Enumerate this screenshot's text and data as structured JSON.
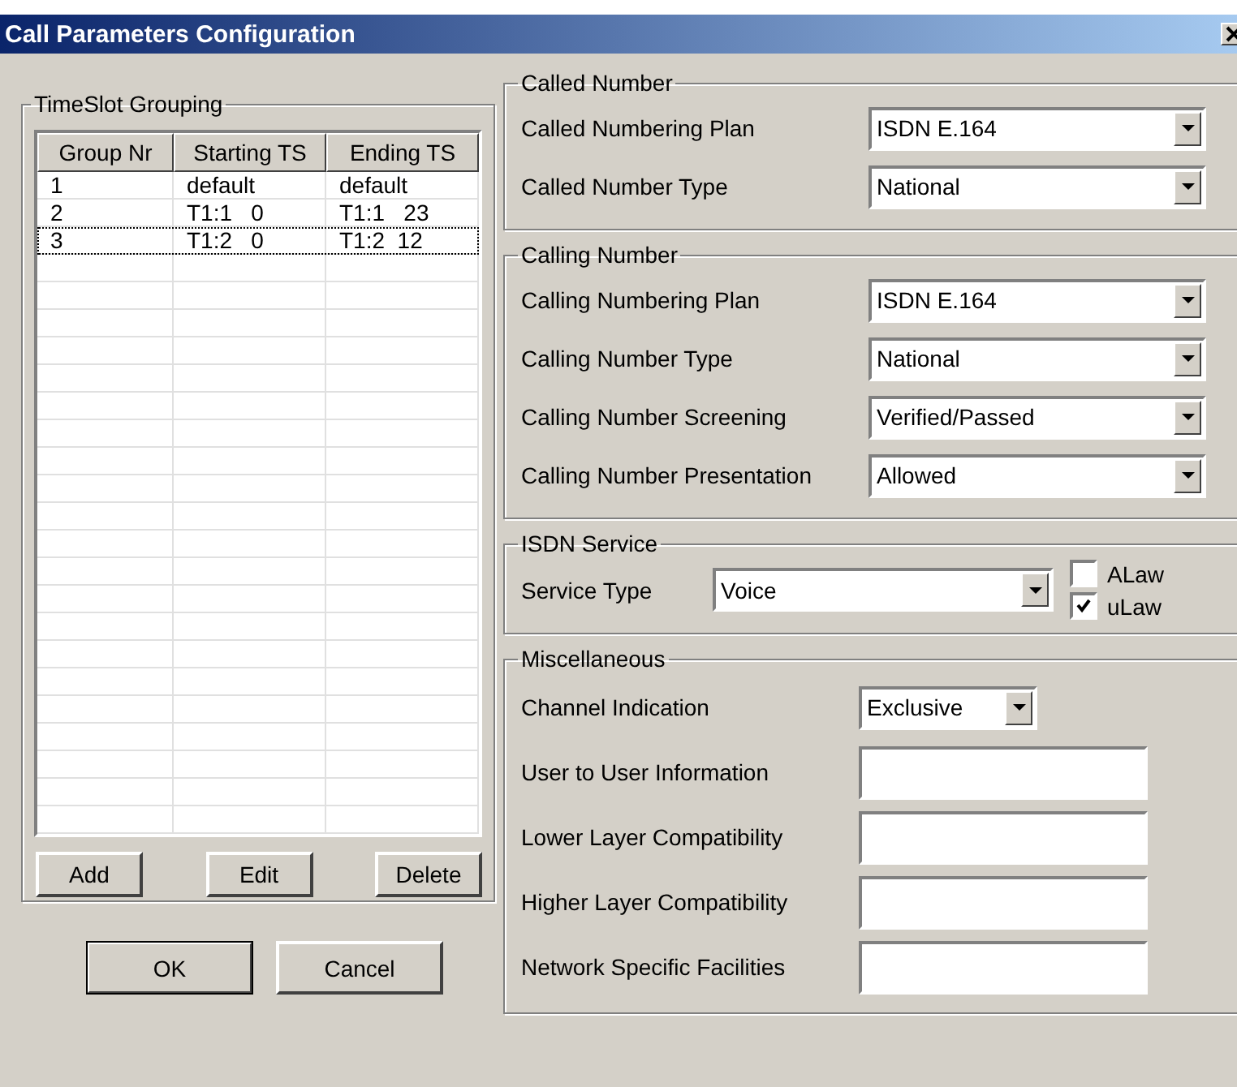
{
  "window": {
    "title": "Call Parameters Configuration"
  },
  "timeslot_grouping": {
    "title": "TimeSlot Grouping",
    "columns": [
      "Group Nr",
      "Starting TS",
      "Ending TS"
    ],
    "rows": [
      {
        "cells": [
          "1",
          "default",
          "default"
        ],
        "selected": false
      },
      {
        "cells": [
          "2",
          "T1:1   0",
          "T1:1   23"
        ],
        "selected": false
      },
      {
        "cells": [
          "3",
          "T1:2   0",
          "T1:2  12"
        ],
        "selected": true
      }
    ],
    "buttons": [
      "Add",
      "Edit",
      "Delete"
    ]
  },
  "dialog_buttons": [
    {
      "label": "OK",
      "default": true
    },
    {
      "label": "Cancel",
      "default": false
    }
  ],
  "called_number": {
    "title": "Called Number",
    "fields": [
      {
        "label": "Called Numbering Plan",
        "value": "ISDN E.164"
      },
      {
        "label": "Called Number Type",
        "value": "National"
      }
    ]
  },
  "calling_number": {
    "title": "Calling Number",
    "fields": [
      {
        "label": "Calling Numbering Plan",
        "value": "ISDN E.164"
      },
      {
        "label": "Calling Number Type",
        "value": "National"
      },
      {
        "label": "Calling Number Screening",
        "value": "Verified/Passed"
      },
      {
        "label": "Calling Number Presentation",
        "value": "Allowed"
      }
    ]
  },
  "isdn_service": {
    "title": "ISDN Service",
    "service_type": {
      "label": "Service Type",
      "value": "Voice"
    },
    "checkboxes": [
      {
        "label": "ALaw",
        "checked": false
      },
      {
        "label": "uLaw",
        "checked": true
      }
    ]
  },
  "miscellaneous": {
    "title": "Miscellaneous",
    "fields": [
      {
        "label": "Channel Indication",
        "kind": "dropdown",
        "value": "Exclusive"
      },
      {
        "label": "User to User Information",
        "kind": "text"
      },
      {
        "label": "Lower Layer Compatibility",
        "kind": "text"
      },
      {
        "label": "Higher Layer Compatibility",
        "kind": "text"
      },
      {
        "label": "Network Specific Facilities",
        "kind": "text"
      }
    ]
  }
}
